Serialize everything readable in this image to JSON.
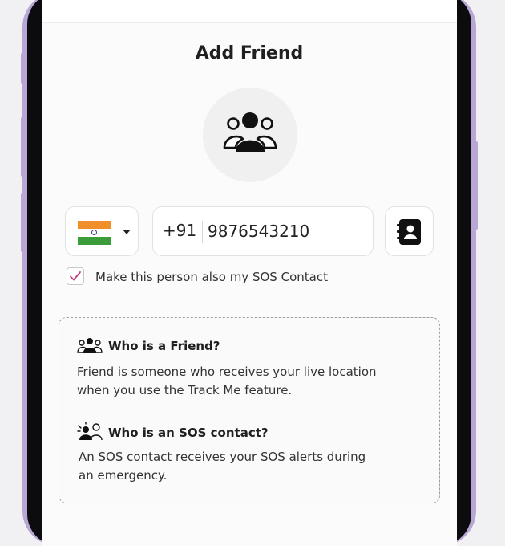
{
  "screen": {
    "title": "Add Friend"
  },
  "avatar": {
    "icon": "friends-group-icon"
  },
  "phone": {
    "country_flag": "india-flag-icon",
    "dial_code": "+91",
    "number": "9876543210",
    "contacts_icon": "contact-book-icon"
  },
  "sos_checkbox": {
    "label": "Make this person also my SOS Contact",
    "checked": true,
    "check_color": "#c23a7a"
  },
  "info": {
    "friend_icon": "friends-group-icon",
    "friend_heading": "Who is a Friend?",
    "friend_line1": "Friend is someone who receives your live location",
    "friend_line2": "when you use the Track Me feature.",
    "sos_icon": "sos-contact-icon",
    "sos_heading": "Who is an SOS contact?",
    "sos_line1": "An SOS contact receives your SOS alerts during",
    "sos_line2": "an emergency."
  },
  "colors": {
    "frame": "#b9a6d4",
    "text": "#1f1f1f",
    "border": "#e2e2e2"
  }
}
